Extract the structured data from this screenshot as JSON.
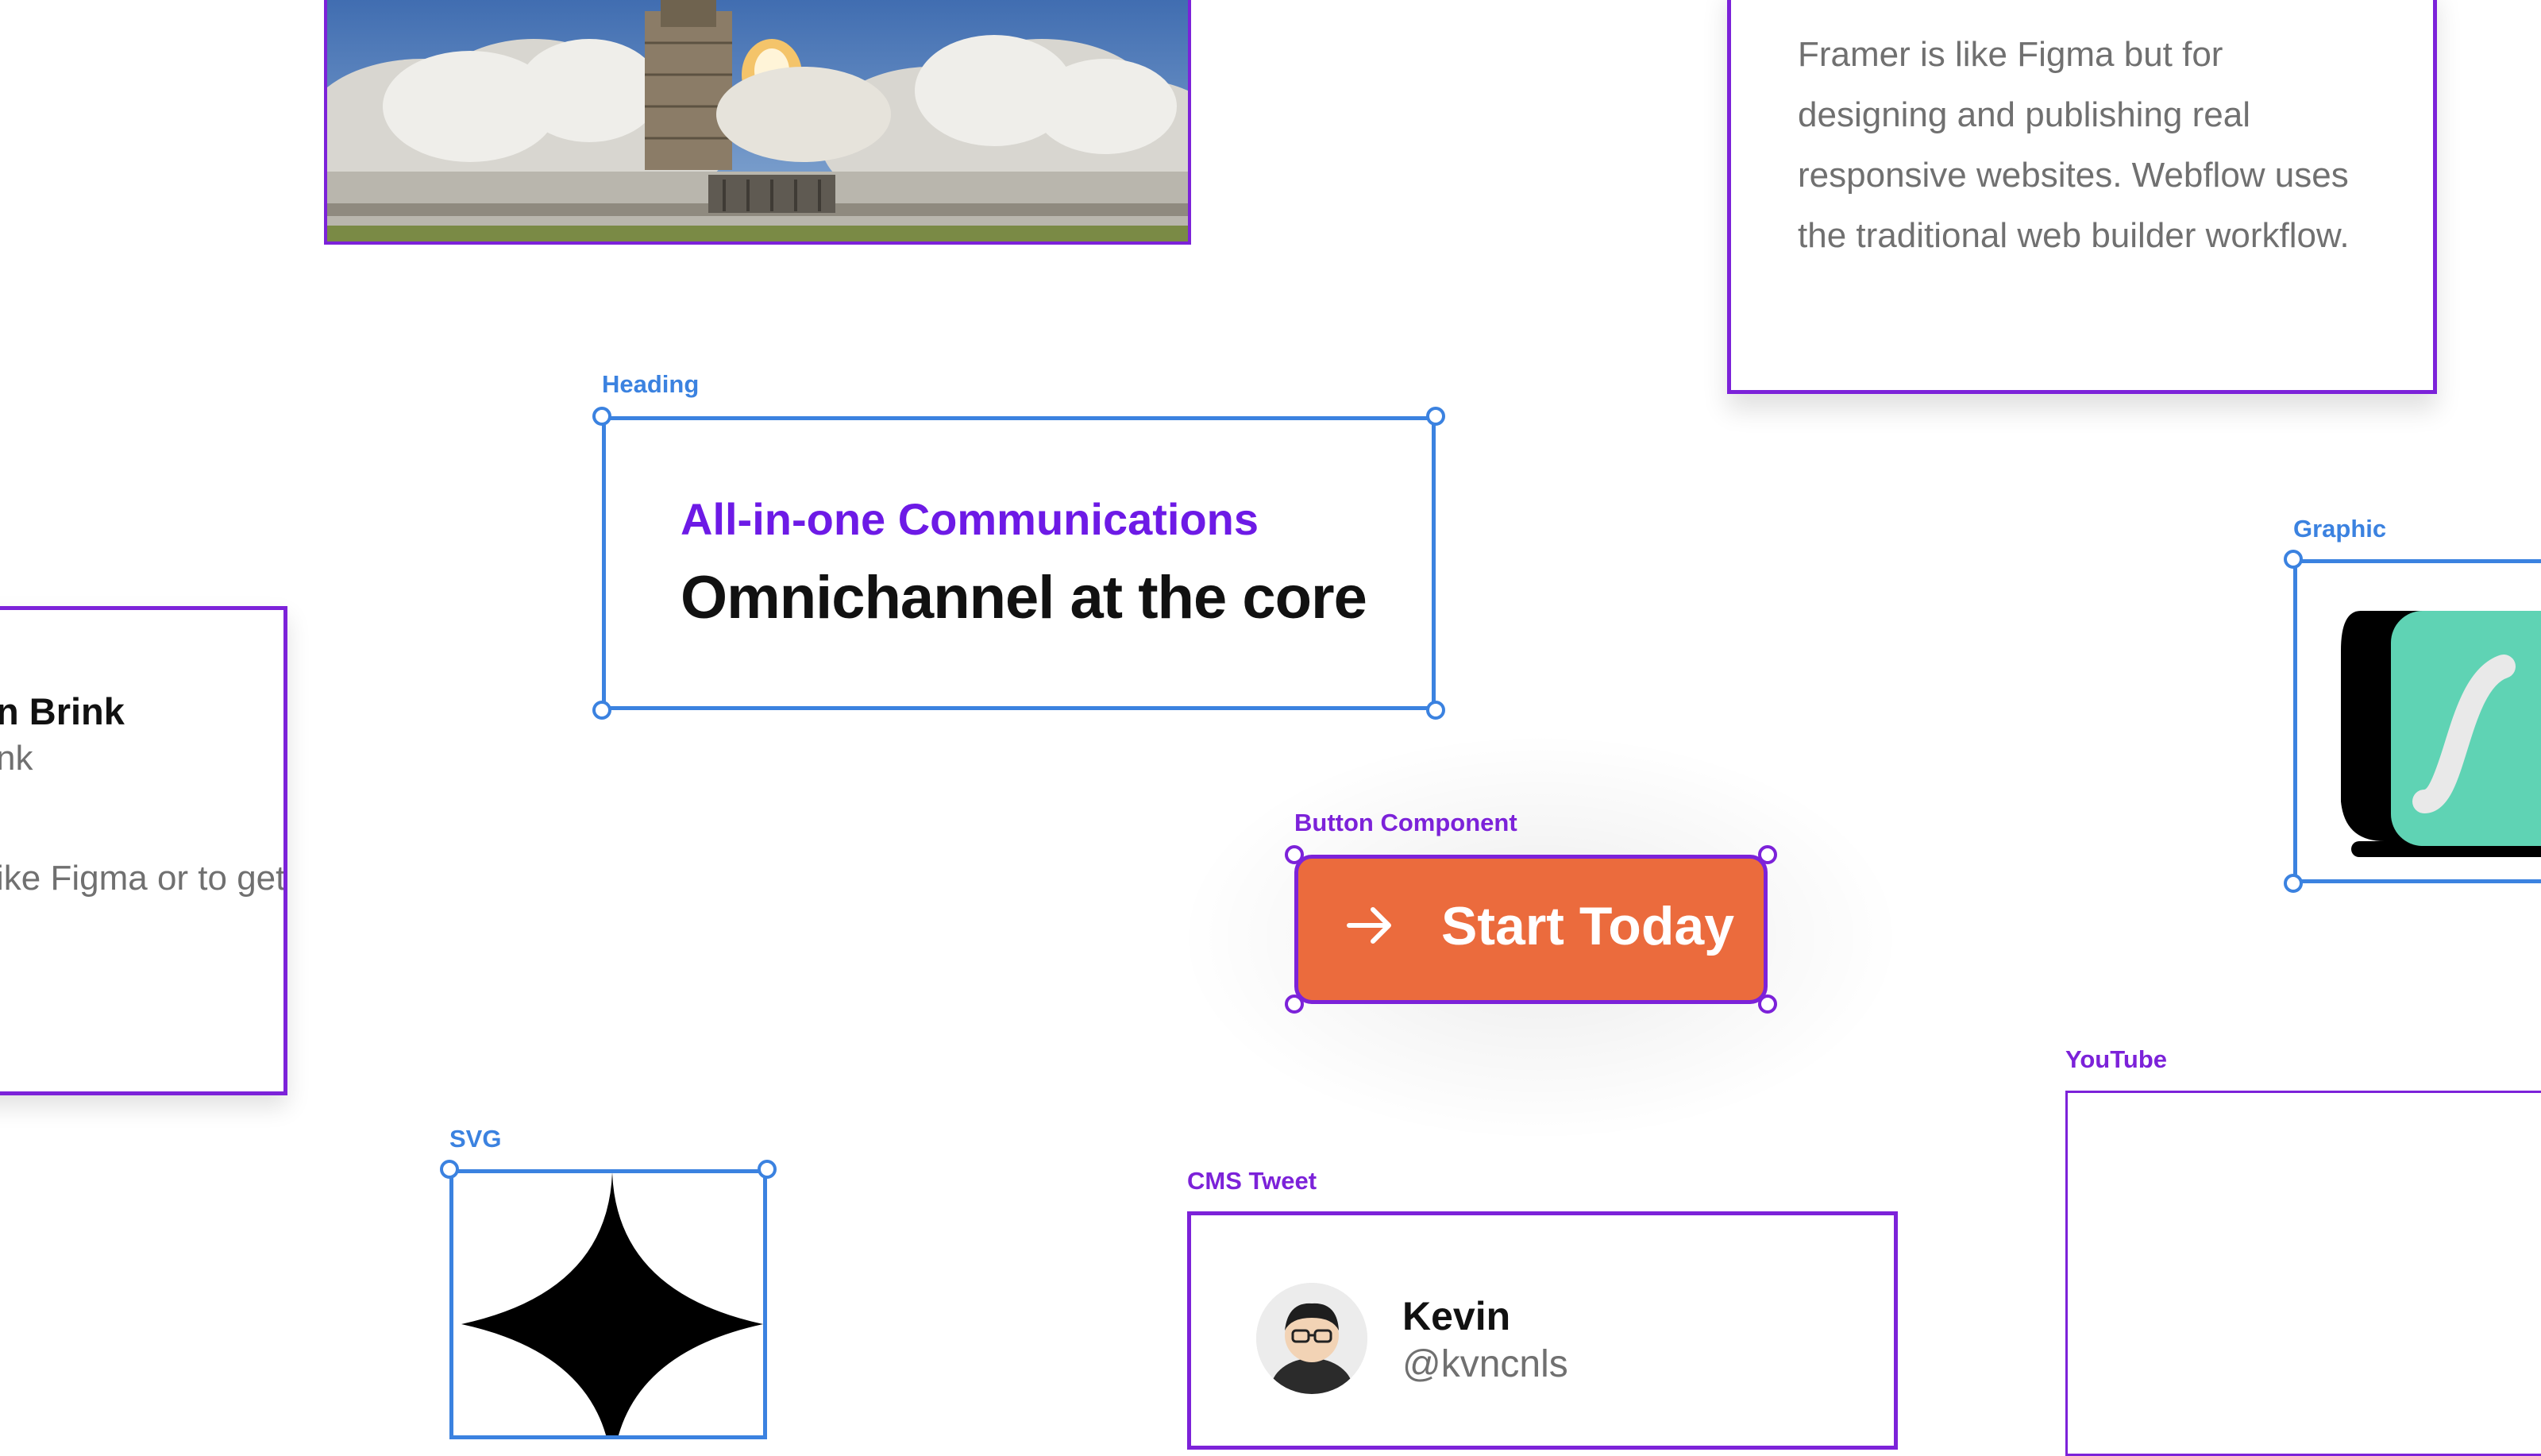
{
  "canvas": {
    "rocket": {
      "alt": "Space shuttle launch"
    },
    "framer_card": {
      "text": "Framer is like Figma but for designing and publishing real responsive websites. Webflow uses the traditional web builder workflow."
    },
    "heading": {
      "label": "Heading",
      "subtitle": "All-in-one Communications",
      "title": "Omnichannel at the core"
    },
    "profile_card": {
      "name": "n Brink",
      "handle": "nk",
      "text": "ike Figma or to get"
    },
    "graphic": {
      "label": "Graphic"
    },
    "button_component": {
      "label": "Button Component",
      "button_text": "Start Today",
      "button_color": "#eb6b3d"
    },
    "svg": {
      "label": "SVG",
      "icon": "four-point-star-icon"
    },
    "cms_tweet": {
      "label": "CMS Tweet",
      "name": "Kevin",
      "handle": "@kvncnls"
    },
    "youtube": {
      "label": "YouTube"
    }
  },
  "colors": {
    "selection_blue": "#3b82e0",
    "selection_purple": "#7c22d9",
    "heading_accent": "#6d1ae6",
    "button_orange": "#eb6b3d",
    "graphic_green": "#5fd3b4"
  }
}
